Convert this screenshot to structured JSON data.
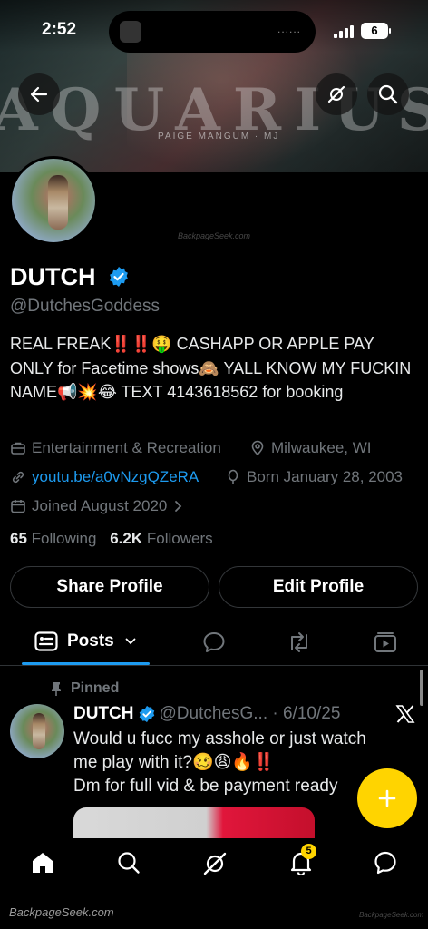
{
  "status_bar": {
    "time": "2:52",
    "battery": "6",
    "island_indicator": "......"
  },
  "banner": {
    "word": "AQUARIUS",
    "credit": "PAIGE MANGUM · MJ"
  },
  "watermarks": {
    "center": "BackpageSeek.com",
    "footer": "BackpageSeek.com",
    "corner": "BackpageSeek.com"
  },
  "profile": {
    "name": "DUTCH",
    "handle": "@DutchesGoddess",
    "bio": "REAL FREAK‼️‼️🤑 CASHAPP OR APPLE PAY ONLY for Facetime shows🙈 YALL KNOW MY FUCKIN NAME📢💥😂 TEXT 4143618562 for booking",
    "category": "Entertainment & Recreation",
    "location": "Milwaukee, WI",
    "link": "youtu.be/a0vNzgQZeRA",
    "birthday": "Born January 28, 2003",
    "joined": "Joined August 2020",
    "following_count": "65",
    "following_label": "Following",
    "followers_count": "6.2K",
    "followers_label": "Followers"
  },
  "buttons": {
    "share": "Share Profile",
    "edit": "Edit Profile"
  },
  "tabs": {
    "posts": "Posts"
  },
  "post": {
    "pinned_label": "Pinned",
    "name": "DUTCH",
    "handle_date": "@DutchesG... · 6/10/25",
    "text_line1": "Would u fucc my asshole or just watch me play with it?🥴😩🔥‼️",
    "text_line2": "Dm for full vid & be payment ready"
  },
  "nav": {
    "notifications_badge": "5"
  },
  "colors": {
    "accent": "#1d9bf0",
    "fab": "#ffd400",
    "muted": "#71767b"
  }
}
